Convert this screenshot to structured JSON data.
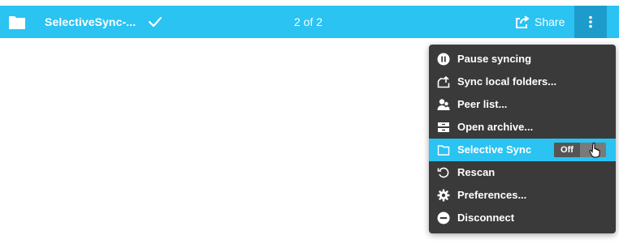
{
  "topbar": {
    "title": "SelectiveSync-...",
    "pager": "2 of 2",
    "share_label": "Share"
  },
  "menu": {
    "items": [
      {
        "label": "Pause syncing",
        "icon": "pause-icon"
      },
      {
        "label": "Sync local folders...",
        "icon": "upload-folder-icon"
      },
      {
        "label": "Peer list...",
        "icon": "users-icon"
      },
      {
        "label": "Open archive...",
        "icon": "archive-icon"
      },
      {
        "label": "Selective Sync",
        "icon": "folder-outline-icon",
        "active": true,
        "toggle_label": "Off"
      },
      {
        "label": "Rescan",
        "icon": "rescan-icon"
      },
      {
        "label": "Preferences...",
        "icon": "gear-icon"
      },
      {
        "label": "Disconnect",
        "icon": "minus-circle-icon"
      }
    ]
  },
  "colors": {
    "accent": "#2ac3f2",
    "menu_bg": "#3a3a3a"
  }
}
